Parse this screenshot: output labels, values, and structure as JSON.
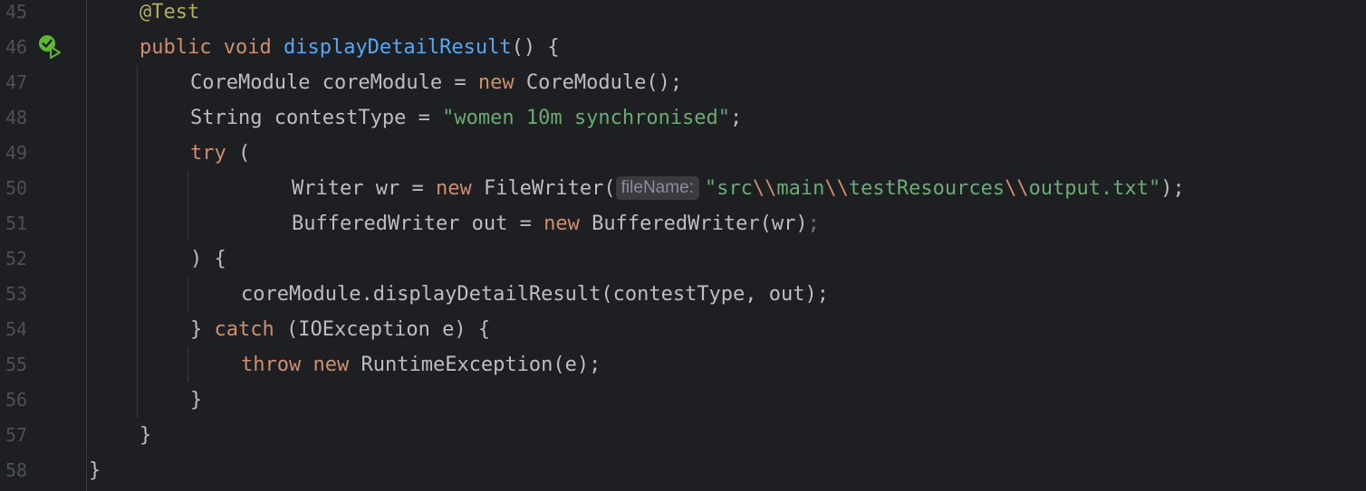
{
  "editor": {
    "language": "java",
    "run_icon": "run-test-passed-icon",
    "lines": [
      {
        "num": "45",
        "tokens": [
          {
            "t": "@Test",
            "c": "ann"
          }
        ]
      },
      {
        "num": "46",
        "tokens": [
          {
            "t": "public",
            "c": "kw"
          },
          {
            "t": " "
          },
          {
            "t": "void",
            "c": "kw"
          },
          {
            "t": " "
          },
          {
            "t": "displayDetailResult",
            "c": "fn"
          },
          {
            "t": "() {"
          }
        ]
      },
      {
        "num": "47",
        "tokens": [
          {
            "t": "CoreModule coreModule = "
          },
          {
            "t": "new",
            "c": "kw"
          },
          {
            "t": " CoreModule();"
          }
        ]
      },
      {
        "num": "48",
        "tokens": [
          {
            "t": "String contestType = "
          },
          {
            "t": "\"women 10m synchronised\"",
            "c": "str"
          },
          {
            "t": ";"
          }
        ]
      },
      {
        "num": "49",
        "tokens": [
          {
            "t": "try",
            "c": "kw"
          },
          {
            "t": " ("
          }
        ]
      },
      {
        "num": "50",
        "tokens": [
          {
            "t": "Writer wr = "
          },
          {
            "t": "new",
            "c": "kw"
          },
          {
            "t": " FileWriter("
          },
          {
            "hint": "fileName:"
          },
          {
            "t": "\"src",
            "c": "str"
          },
          {
            "t": "\\\\",
            "c": "esc"
          },
          {
            "t": "main",
            "c": "str"
          },
          {
            "t": "\\\\",
            "c": "esc"
          },
          {
            "t": "testResources",
            "c": "str"
          },
          {
            "t": "\\\\",
            "c": "esc"
          },
          {
            "t": "output.txt\"",
            "c": "str"
          },
          {
            "t": ");"
          }
        ]
      },
      {
        "num": "51",
        "tokens": [
          {
            "t": "BufferedWriter out = "
          },
          {
            "t": "new",
            "c": "kw"
          },
          {
            "t": " BufferedWriter(wr)"
          },
          {
            "t": ";",
            "c": "dim"
          }
        ]
      },
      {
        "num": "52",
        "tokens": [
          {
            "t": ") {"
          }
        ]
      },
      {
        "num": "53",
        "tokens": [
          {
            "t": "coreModule.displayDetailResult(contestType, out);"
          }
        ]
      },
      {
        "num": "54",
        "tokens": [
          {
            "t": "} "
          },
          {
            "t": "catch",
            "c": "kw"
          },
          {
            "t": " (IOException e) {"
          }
        ]
      },
      {
        "num": "55",
        "tokens": [
          {
            "t": "throw",
            "c": "kw"
          },
          {
            "t": " "
          },
          {
            "t": "new",
            "c": "kw"
          },
          {
            "t": " RuntimeException(e);"
          }
        ]
      },
      {
        "num": "56",
        "tokens": [
          {
            "t": "}"
          }
        ]
      },
      {
        "num": "57",
        "tokens": [
          {
            "t": "}"
          }
        ]
      },
      {
        "num": "58",
        "tokens": [
          {
            "t": "}"
          }
        ]
      }
    ]
  },
  "colors": {
    "background": "#1e1f22",
    "text": "#bcbec4",
    "keyword": "#cf8e6d",
    "string": "#6aab73",
    "annotation": "#b3ae60",
    "method": "#56a8f5",
    "line_number": "#4b5059"
  }
}
